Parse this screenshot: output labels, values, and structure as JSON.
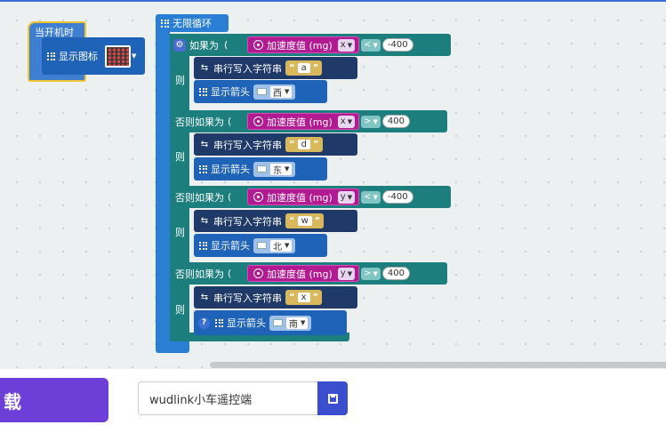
{
  "on_start": {
    "label": "当开机时",
    "show_icon_label": "显示图标"
  },
  "forever": {
    "label": "无限循环"
  },
  "if_labels": {
    "if": "如果为",
    "then": "则",
    "else_if": "否则如果为"
  },
  "serial_label": "串行写入字符串",
  "show_arrow_label": "显示箭头",
  "accel_label": "加速度值 (mg)",
  "branches": [
    {
      "axis": "x",
      "op": "<",
      "value": "-400",
      "char": "a",
      "arrow": "西"
    },
    {
      "axis": "x",
      "op": ">",
      "value": "400",
      "char": "d",
      "arrow": "东"
    },
    {
      "axis": "y",
      "op": "<",
      "value": "-400",
      "char": "w",
      "arrow": "北"
    },
    {
      "axis": "y",
      "op": ">",
      "value": "400",
      "char": "x",
      "arrow": "南"
    }
  ],
  "toolbar": {
    "download_label": "载",
    "project_name": "wudlink小车遥控端"
  },
  "colors": {
    "event": "#3f7fd2",
    "loop": "#2a7fd4",
    "logic": "#1d7f7d",
    "serial": "#1f3a68",
    "led": "#1e63b8",
    "input": "#b11a91",
    "download": "#6d3ed8",
    "save": "#3b4fce"
  }
}
